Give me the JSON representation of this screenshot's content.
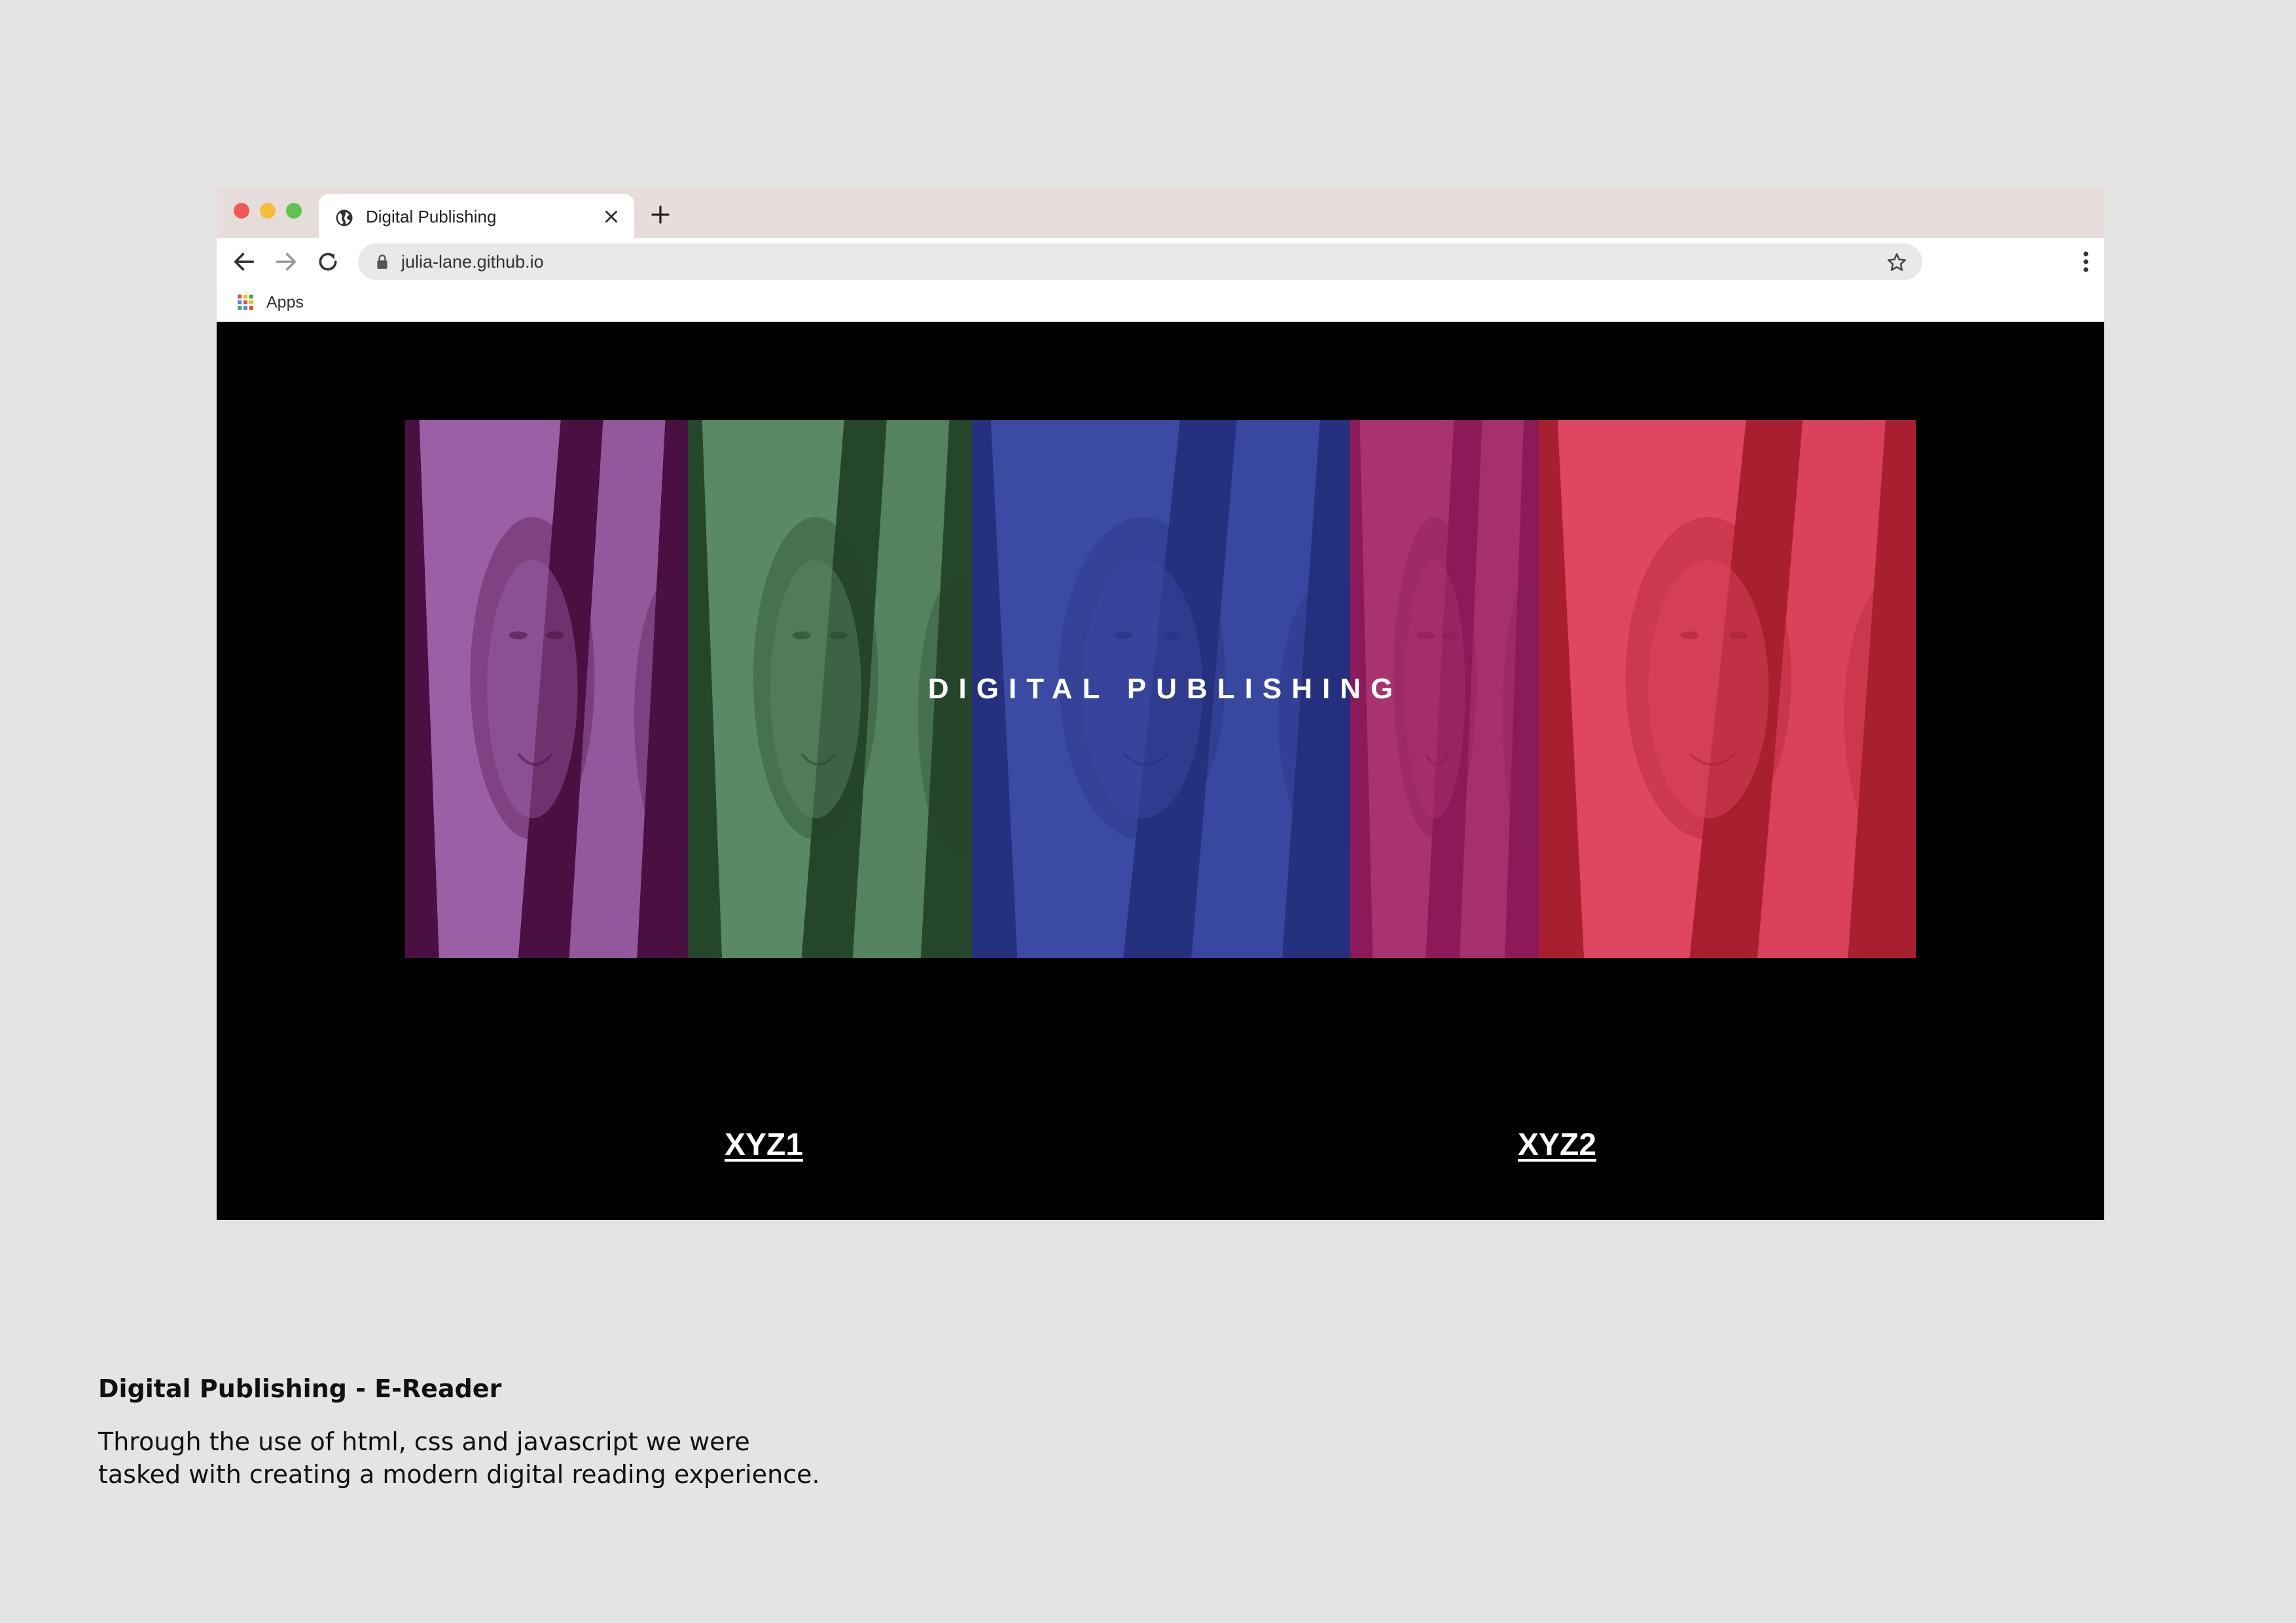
{
  "browser": {
    "tab": {
      "title": "Digital Publishing"
    },
    "address_bar": {
      "url": "julia-lane.github.io"
    },
    "bookmarks": {
      "apps_label": "Apps"
    },
    "icons": [
      "close-window-dot",
      "minimize-window-dot",
      "maximize-window-dot",
      "globe-icon",
      "close-icon",
      "plus-icon",
      "back-arrow-icon",
      "forward-arrow-icon",
      "reload-icon",
      "lock-icon",
      "star-icon",
      "kebab-menu-icon",
      "apps-grid-icon"
    ]
  },
  "page": {
    "hero_title": "DIGITAL PUBLISHING",
    "hero_panels": [
      {
        "color": "#9b5fa6",
        "dark": "#4a1042"
      },
      {
        "color": "#5a8a63",
        "dark": "#24462a"
      },
      {
        "color": "#3b4aa3",
        "dark": "#25307f"
      },
      {
        "color": "#a8336e",
        "dark": "#8c1a58"
      },
      {
        "color": "#df4662",
        "dark": "#a8202f"
      }
    ],
    "links": [
      {
        "label": "XYZ1"
      },
      {
        "label": "XYZ2"
      }
    ]
  },
  "caption": {
    "title": "Digital Publishing - E-Reader",
    "body_line_1": "Through the use of html, css and javascript we were",
    "body_line_2": "tasked with creating a modern digital reading experience."
  }
}
